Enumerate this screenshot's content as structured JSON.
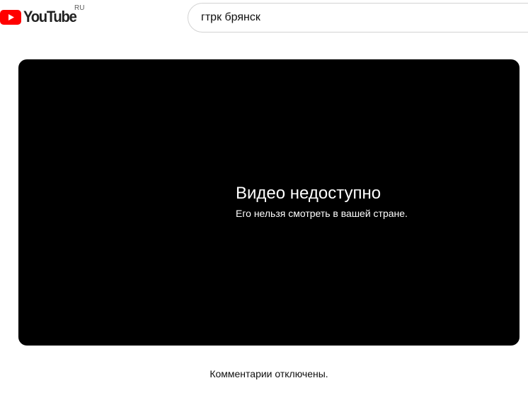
{
  "header": {
    "logo_text": "YouTube",
    "country_code": "RU",
    "logo_color": "#FF0000"
  },
  "search": {
    "query": "гтрк брянск"
  },
  "player": {
    "error_title": "Видео недоступно",
    "error_subtitle": "Его нельзя смотреть в вашей стране."
  },
  "comments": {
    "status_text": "Комментарии отключены."
  }
}
